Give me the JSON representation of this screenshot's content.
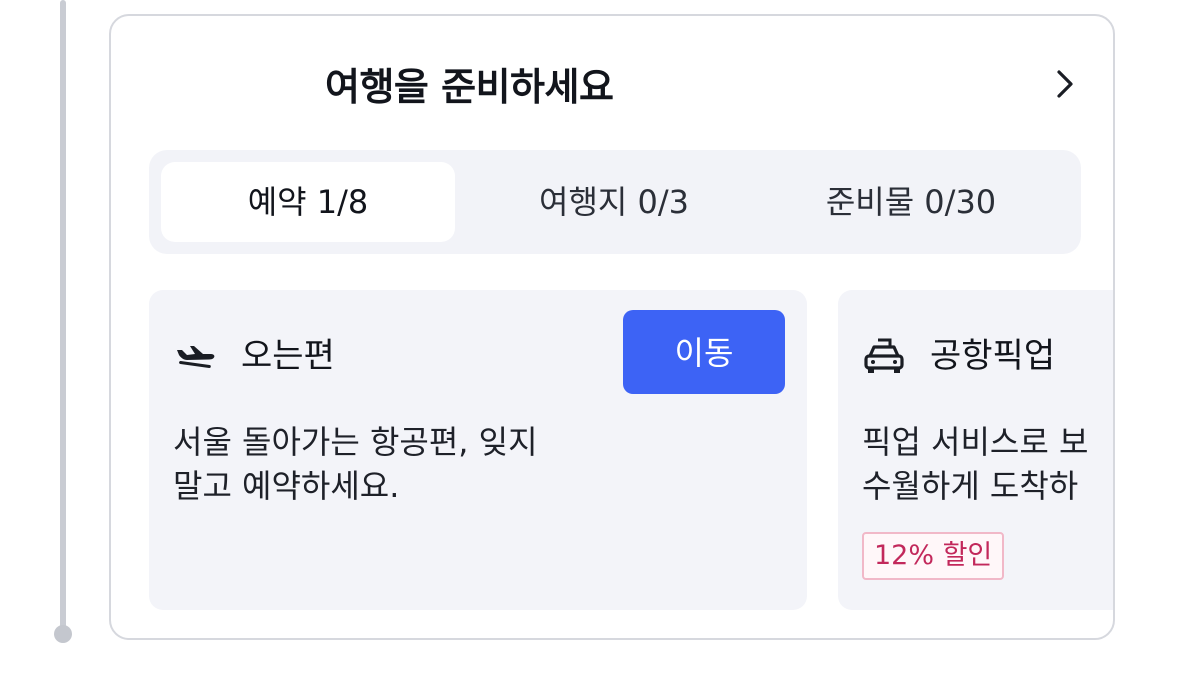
{
  "card": {
    "title": "여행을 준비하세요",
    "chevron_icon": "chevron-right-icon"
  },
  "tabs": [
    {
      "label": "예약 1/8",
      "active": true
    },
    {
      "label": "여행지 0/3",
      "active": false
    },
    {
      "label": "준비물 0/30",
      "active": false
    }
  ],
  "items": [
    {
      "icon": "airplane-landing-icon",
      "title": "오는편",
      "button_label": "이동",
      "description": "서울 돌아가는 항공편, 잊지\n말고 예약하세요."
    },
    {
      "icon": "car-icon",
      "title": "공항픽업",
      "description": "픽업 서비스로 보\n수월하게 도착하",
      "badge": "12% 할인"
    }
  ],
  "colors": {
    "accent": "#3d63f5",
    "badge_text": "#c2285b",
    "badge_border": "#f1b8c8",
    "tab_bg": "#f2f3f8",
    "item_bg": "#f3f4f9"
  }
}
